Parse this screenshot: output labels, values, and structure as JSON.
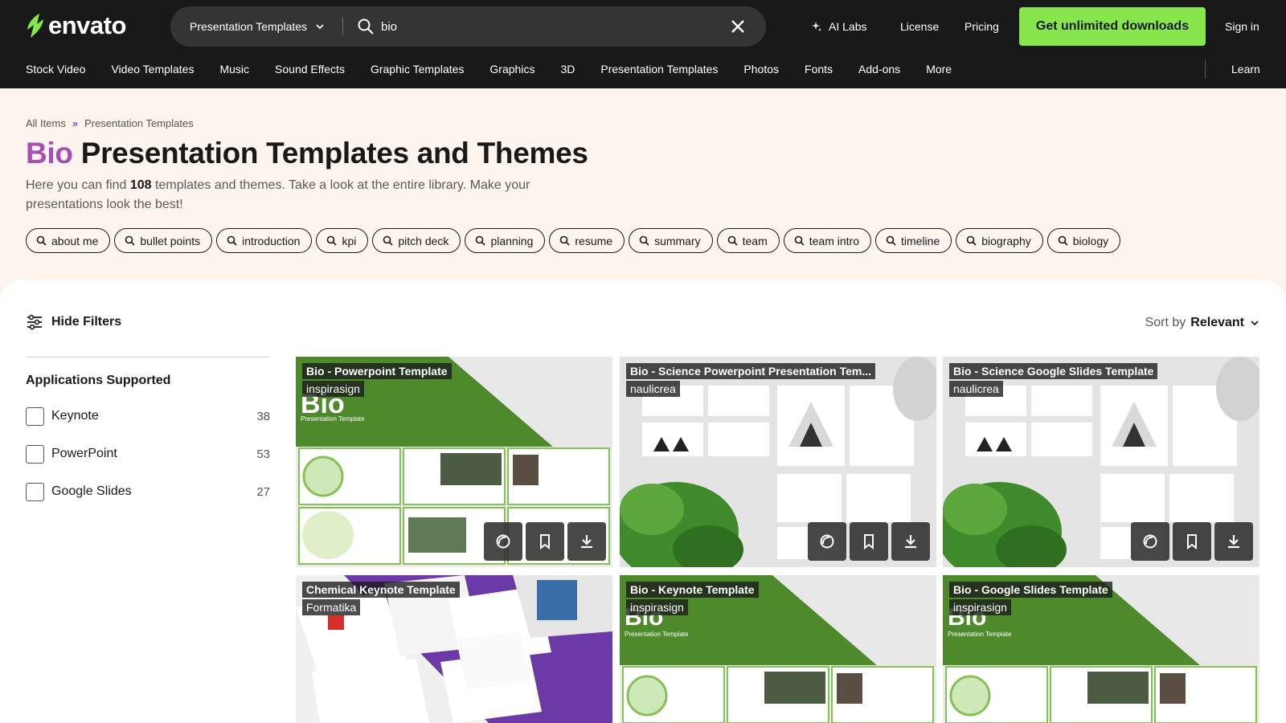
{
  "brand": {
    "name": "envato",
    "accent": "#87e64b",
    "highlight": "#a64fb4"
  },
  "header": {
    "search": {
      "category": "Presentation Templates",
      "value": "bio"
    },
    "ai_labs": "AI Labs",
    "license": "License",
    "pricing": "Pricing",
    "cta": "Get unlimited downloads",
    "signin": "Sign in"
  },
  "categories": [
    "Stock Video",
    "Video Templates",
    "Music",
    "Sound Effects",
    "Graphic Templates",
    "Graphics",
    "3D",
    "Presentation Templates",
    "Photos",
    "Fonts",
    "Add-ons",
    "More"
  ],
  "learn": "Learn",
  "breadcrumb": {
    "root": "All Items",
    "sep": "»",
    "current": "Presentation Templates"
  },
  "title": {
    "keyword": "Bio",
    "rest": "Presentation Templates and Themes"
  },
  "description": {
    "pre": "Here you can find",
    "count": "108",
    "post": "templates and themes. Take a look at the entire library. Make your presentations look the best!"
  },
  "tags": [
    "about me",
    "bullet points",
    "introduction",
    "kpi",
    "pitch deck",
    "planning",
    "resume",
    "summary",
    "team",
    "team intro",
    "timeline",
    "biography",
    "biology"
  ],
  "toolbar": {
    "hide_filters": "Hide Filters",
    "sort_prefix": "Sort by",
    "sort_value": "Relevant"
  },
  "filters": {
    "title": "Applications Supported",
    "options": [
      {
        "label": "Keynote",
        "count": "38"
      },
      {
        "label": "PowerPoint",
        "count": "53"
      },
      {
        "label": "Google Slides",
        "count": "27"
      }
    ]
  },
  "items": [
    {
      "title": "Bio - Powerpoint Template",
      "author": "inspirasign",
      "style": "bio-green"
    },
    {
      "title": "Bio - Science Powerpoint Presentation Tem...",
      "author": "naulicrea",
      "style": "science"
    },
    {
      "title": "Bio - Science Google Slides Template",
      "author": "naulicrea",
      "style": "science"
    },
    {
      "title": "Chemical Keynote Template",
      "author": "Formatika",
      "style": "chemical"
    },
    {
      "title": "Bio - Keynote Template",
      "author": "inspirasign",
      "style": "bio-green"
    },
    {
      "title": "Bio - Google Slides Template",
      "author": "inspirasign",
      "style": "bio-green"
    }
  ]
}
